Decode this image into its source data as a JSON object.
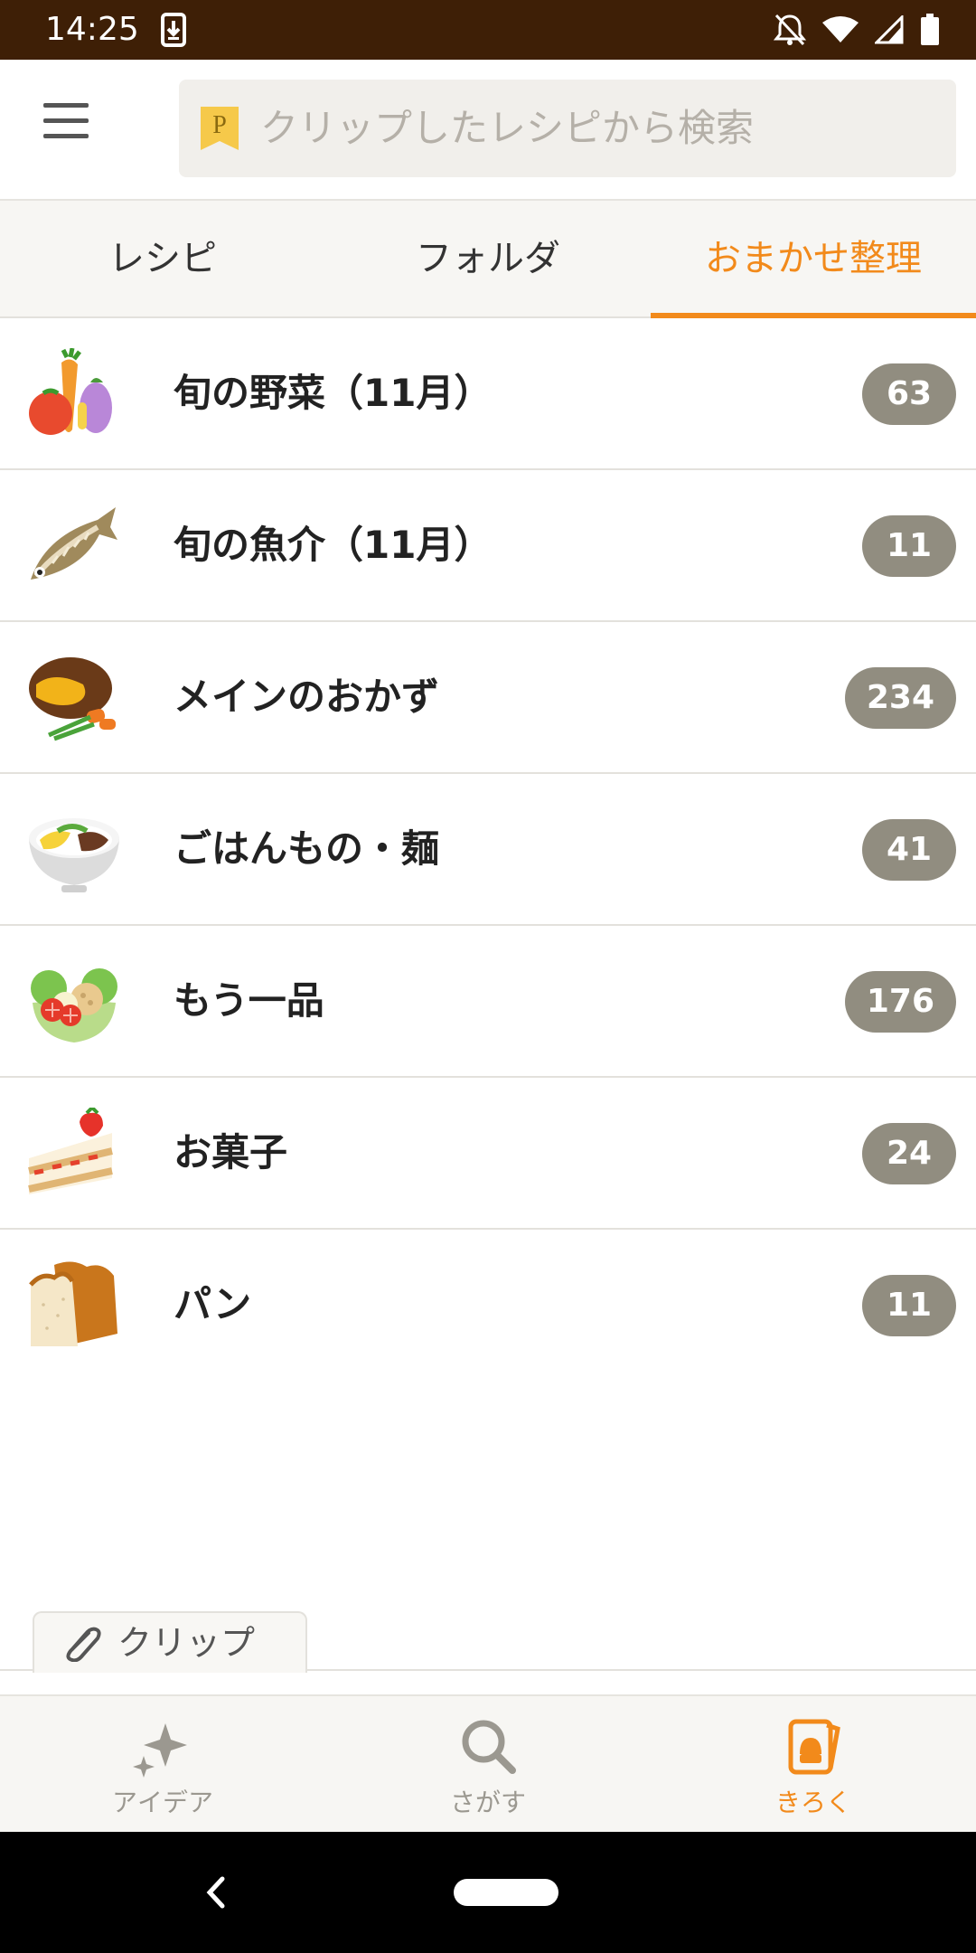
{
  "status_bar": {
    "time": "14:25"
  },
  "search": {
    "placeholder": "クリップしたレシピから検索",
    "badge": "P"
  },
  "tabs": [
    {
      "label": "レシピ",
      "active": false
    },
    {
      "label": "フォルダ",
      "active": false
    },
    {
      "label": "おまかせ整理",
      "active": true
    }
  ],
  "categories": [
    {
      "title": "旬の野菜（11月）",
      "count": "63",
      "icon": "vegetables-icon"
    },
    {
      "title": "旬の魚介（11月）",
      "count": "11",
      "icon": "fish-icon"
    },
    {
      "title": "メインのおかず",
      "count": "234",
      "icon": "hamburg-steak-icon"
    },
    {
      "title": "ごはんもの・麺",
      "count": "41",
      "icon": "rice-bowl-icon"
    },
    {
      "title": "もう一品",
      "count": "176",
      "icon": "salad-icon"
    },
    {
      "title": "お菓子",
      "count": "24",
      "icon": "cake-icon"
    },
    {
      "title": "パン",
      "count": "11",
      "icon": "bread-icon"
    }
  ],
  "clip_tab": {
    "label": "クリップ"
  },
  "bottom_nav": [
    {
      "label": "アイデア",
      "icon": "sparkle-icon",
      "active": false
    },
    {
      "label": "さがす",
      "icon": "search-icon",
      "active": false
    },
    {
      "label": "きろく",
      "icon": "record-icon",
      "active": true
    }
  ],
  "colors": {
    "accent": "#f28a1b",
    "status_bar": "#3e1f06",
    "badge": "#918d80"
  }
}
